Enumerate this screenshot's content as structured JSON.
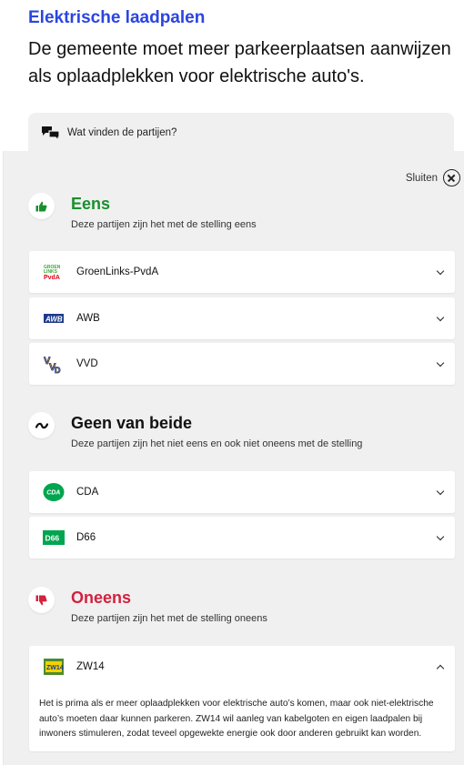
{
  "header": {
    "topic": "Elektrische laadpalen",
    "statement": "De gemeente moet meer parkeerplaatsen aanwijzen als oplaadplekken voor elektrische auto's."
  },
  "tab": {
    "label": "Wat vinden de partijen?",
    "icon": "chat-bubbles-icon"
  },
  "close_label": "Sluiten",
  "groups": [
    {
      "title": "Eens",
      "subtitle": "Deze partijen zijn het met de stelling eens",
      "color": "#1a8f2e",
      "icon": "thumbs-up-icon",
      "parties": [
        {
          "name": "GroenLinks-PvdA",
          "logo_text": "GROEN LINKS PvdA"
        },
        {
          "name": "AWB",
          "logo_text": "AWB"
        },
        {
          "name": "VVD",
          "logo_text": "VVD"
        }
      ]
    },
    {
      "title": "Geen van beide",
      "subtitle": "Deze partijen zijn het niet eens en ook niet oneens met de stelling",
      "color": "#111111",
      "icon": "tilde-icon",
      "parties": [
        {
          "name": "CDA",
          "logo_text": "CDA"
        },
        {
          "name": "D66",
          "logo_text": "D66"
        }
      ]
    },
    {
      "title": "Oneens",
      "subtitle": "Deze partijen zijn het met de stelling oneens",
      "color": "#d3213f",
      "icon": "thumbs-down-icon",
      "parties": [
        {
          "name": "ZW14",
          "logo_text": "ZW14",
          "expanded": true,
          "explanation": "Het is prima als er meer oplaadplekken voor elektrische auto’s komen, maar ook niet-elektrische auto’s moeten daar kunnen parkeren. ZW14 wil aanleg van kabelgoten en eigen laadpalen bij inwoners stimuleren, zodat teveel opgewekte energie ook door anderen gebruikt kan worden."
        }
      ]
    }
  ]
}
